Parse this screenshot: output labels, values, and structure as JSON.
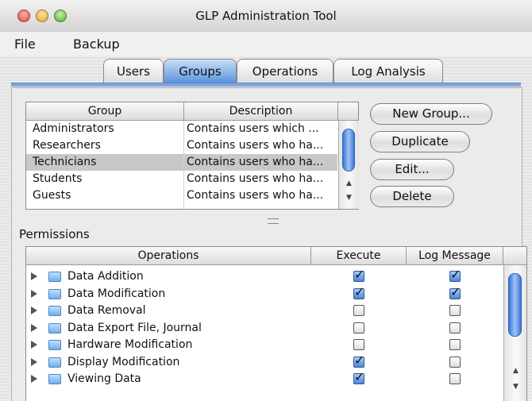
{
  "window": {
    "title": "GLP Administration Tool"
  },
  "menu": {
    "items": [
      "File",
      "Backup"
    ]
  },
  "tabs": [
    {
      "label": "Users",
      "active": false
    },
    {
      "label": "Groups",
      "active": true
    },
    {
      "label": "Operations",
      "active": false
    },
    {
      "label": "Log Analysis",
      "active": false
    }
  ],
  "groups": {
    "columns": [
      "Group",
      "Description"
    ],
    "rows": [
      {
        "group": "Administrators",
        "description": "Contains users which ...",
        "selected": false
      },
      {
        "group": "Researchers",
        "description": "Contains users who ha...",
        "selected": false
      },
      {
        "group": "Technicians",
        "description": "Contains users who ha...",
        "selected": true
      },
      {
        "group": "Students",
        "description": "Contains users who ha...",
        "selected": false
      },
      {
        "group": "Guests",
        "description": "Contains users who ha...",
        "selected": false
      }
    ]
  },
  "buttons": {
    "new_group": "New Group...",
    "duplicate": "Duplicate",
    "edit": "Edit...",
    "delete": "Delete"
  },
  "permissions": {
    "label": "Permissions",
    "columns": [
      "Operations",
      "Execute",
      "Log Message"
    ],
    "rows": [
      {
        "operation": "Data Addition",
        "execute": true,
        "log": true
      },
      {
        "operation": "Data Modification",
        "execute": true,
        "log": true
      },
      {
        "operation": "Data Removal",
        "execute": false,
        "log": false
      },
      {
        "operation": "Data Export File, Journal",
        "execute": false,
        "log": false
      },
      {
        "operation": "Hardware Modification",
        "execute": false,
        "log": false
      },
      {
        "operation": "Display Modification",
        "execute": true,
        "log": false
      },
      {
        "operation": "Viewing Data",
        "execute": true,
        "log": false
      }
    ]
  },
  "colors": {
    "accent": "#5c95dc",
    "selection": "#c8c8c8"
  }
}
